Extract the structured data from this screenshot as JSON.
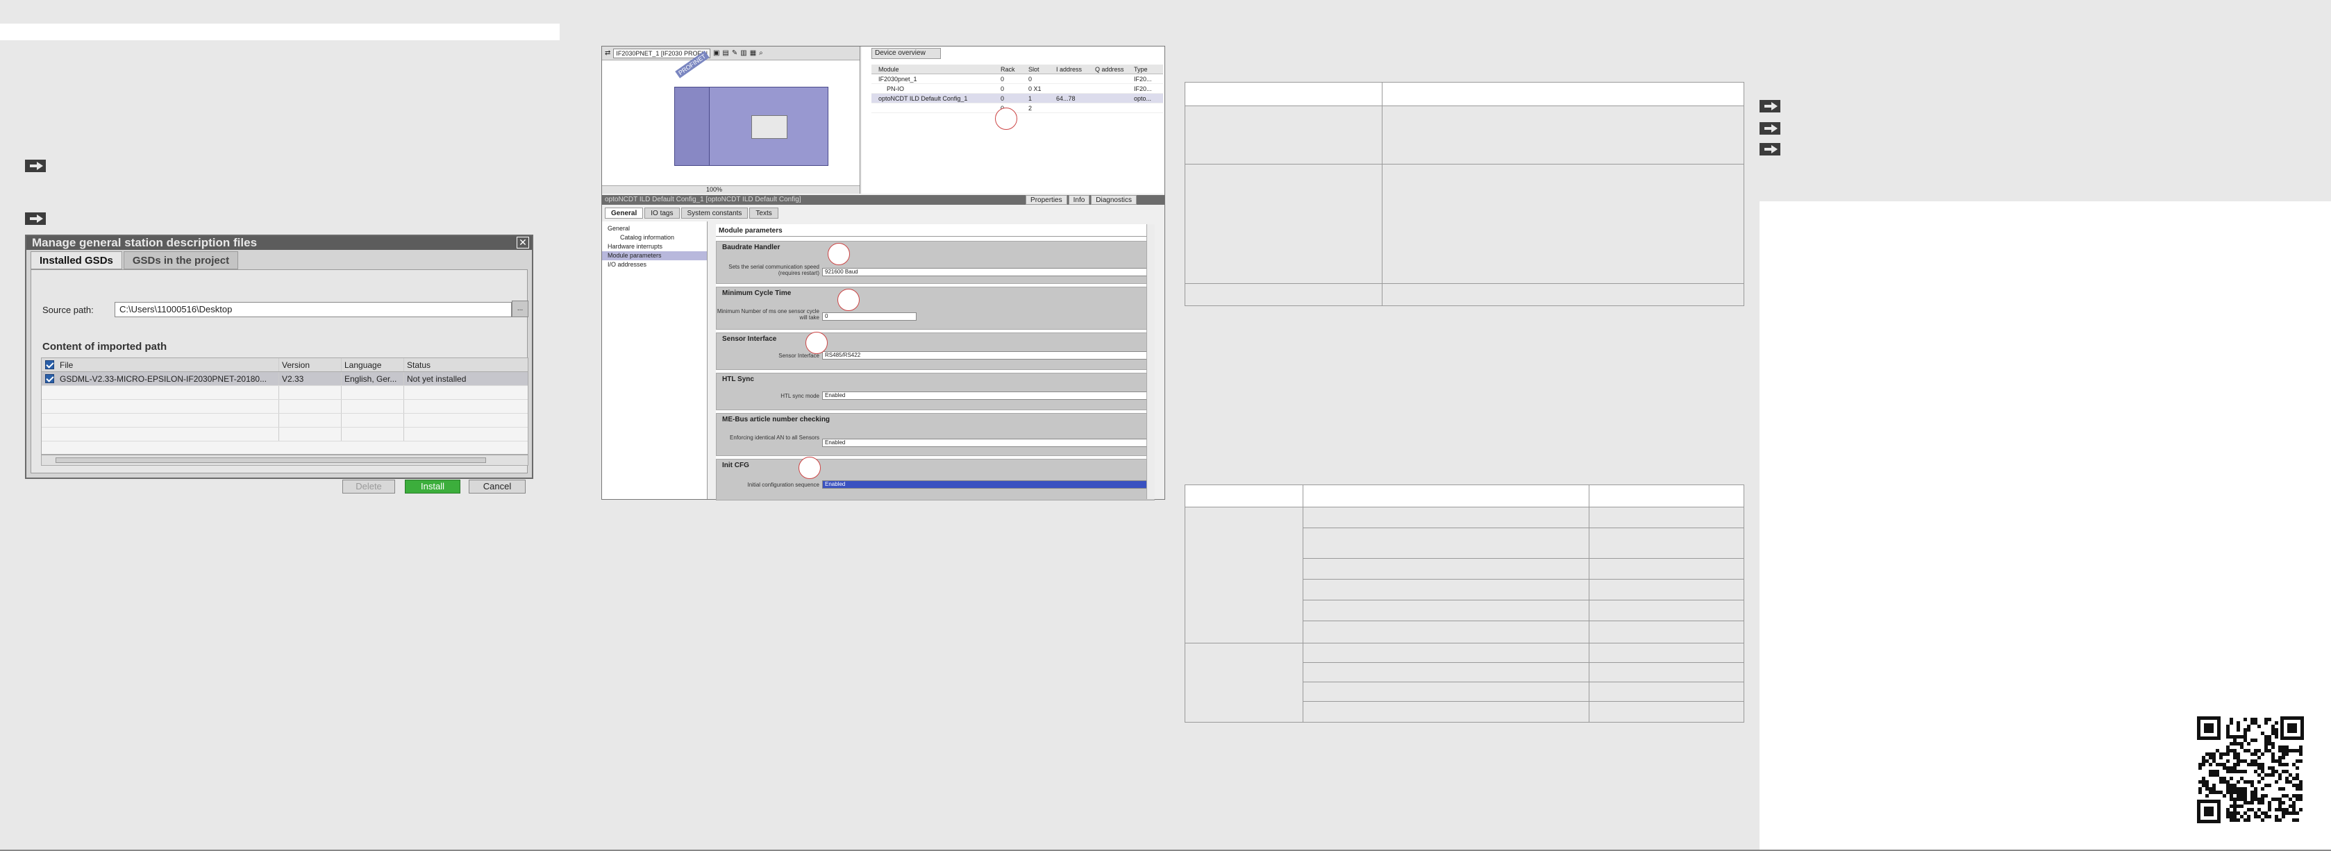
{
  "gsd_dialog": {
    "title": "Manage general station description files",
    "close_glyph": "✕",
    "tabs": [
      "Installed GSDs",
      "GSDs in the project"
    ],
    "source_label": "Source path:",
    "source_value": "C:\\Users\\11000516\\Desktop",
    "browse_glyph": "...",
    "content_heading": "Content of imported path",
    "columns": [
      "File",
      "Version",
      "Language",
      "Status"
    ],
    "rows": [
      {
        "file": "GSDML-V2.33-MICRO-EPSILON-IF2030PNET-20180...",
        "version": "V2.33",
        "language": "English, Ger...",
        "status": "Not yet installed"
      }
    ],
    "buttons": {
      "delete": "Delete",
      "install": "Install",
      "cancel": "Cancel"
    }
  },
  "tia": {
    "device_select": "IF2030PNET_1 [IF2030 PROFIN",
    "zoom": "100%",
    "profinet_label": "PROFINET",
    "device_overview_tab": "Device overview",
    "device_table": {
      "columns": [
        "Module",
        "Rack",
        "Slot",
        "I address",
        "Q address",
        "Type"
      ],
      "rows": [
        {
          "module": "IF2030pnet_1",
          "rack": "0",
          "slot": "0",
          "i": "",
          "q": "",
          "type": "IF20..."
        },
        {
          "module": "PN-IO",
          "rack": "0",
          "slot": "0 X1",
          "i": "",
          "q": "",
          "type": "IF20..."
        },
        {
          "module": "optoNCDT ILD Default Config_1",
          "rack": "0",
          "slot": "1",
          "i": "64...78",
          "q": "",
          "type": "opto..."
        },
        {
          "module": "",
          "rack": "0",
          "slot": "2",
          "i": "",
          "q": "",
          "type": ""
        }
      ]
    },
    "section_title": "optoNCDT ILD Default Config_1 [optoNCDT ILD Default Config]",
    "prop_tabs": [
      "Properties",
      "Info",
      "Diagnostics"
    ],
    "general_tabs": [
      "General",
      "IO tags",
      "System constants",
      "Texts"
    ],
    "nav": [
      {
        "label": "General",
        "sub": false
      },
      {
        "label": "Catalog information",
        "sub": true
      },
      {
        "label": "Hardware interrupts",
        "sub": false
      },
      {
        "label": "Module parameters",
        "sub": false
      },
      {
        "label": "I/O addresses",
        "sub": false
      }
    ],
    "params_title": "Module parameters",
    "groups": {
      "baud": {
        "title": "Baudrate Handler",
        "label": "Sets the serial communication speed (requires restart)",
        "value": "921600 Baud"
      },
      "cycle": {
        "title": "Minimum Cycle Time",
        "label": "Minimum Number of ms one sensor cycle will take",
        "value": "0"
      },
      "iface": {
        "title": "Sensor Interface",
        "label": "Sensor Interface",
        "value": "RS485/RS422"
      },
      "htl": {
        "title": "HTL Sync",
        "label": "HTL sync mode",
        "value": "Enabled"
      },
      "article": {
        "title": "ME-Bus article number checking",
        "label": "Enforcing identical AN to all Sensors",
        "value": "Enabled"
      },
      "init": {
        "title": "Init CFG",
        "label": "Initial configuration sequence",
        "value": "Enabled"
      }
    }
  }
}
